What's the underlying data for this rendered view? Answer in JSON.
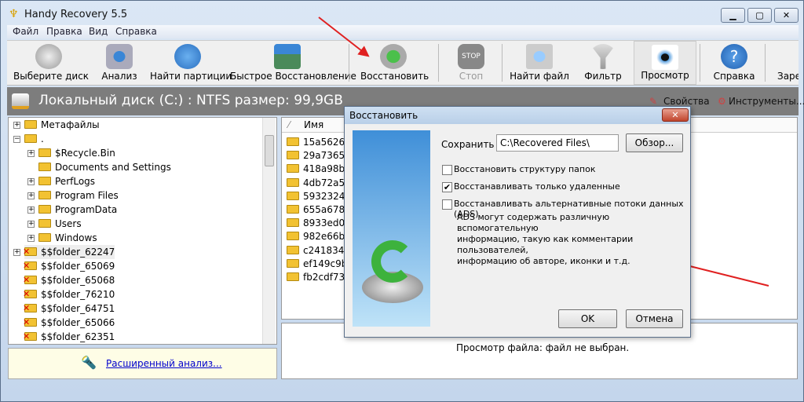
{
  "window": {
    "title": "Handy Recovery 5.5",
    "minimize": "▁",
    "maximize": "▢",
    "close": "✕"
  },
  "menu": [
    "Файл",
    "Правка",
    "Вид",
    "Справка"
  ],
  "toolbar": [
    "Выберите диск",
    "Анализ",
    "Найти партиции",
    "Быстрое Восстановление",
    "Восстановить",
    "Стоп",
    "Найти файл",
    "Фильтр",
    "Просмотр",
    "Справка",
    "Заре"
  ],
  "diskbar": {
    "title": "Локальный диск (C:) : NTFS размер: 99,9GB",
    "properties": "Свойства",
    "tools": "Инструменты..."
  },
  "tree": {
    "root": [
      "Метафайлы",
      "."
    ],
    "children": [
      "$Recycle.Bin",
      "Documents and Settings",
      "PerfLogs",
      "Program Files",
      "ProgramData",
      "Users",
      "Windows"
    ],
    "deleted": [
      "$$folder_62247",
      "$$folder_65069",
      "$$folder_65068",
      "$$folder_76210",
      "$$folder_64751",
      "$$folder_65066",
      "$$folder_62351"
    ]
  },
  "info": {
    "link": "Расширенный анализ..."
  },
  "list": {
    "header": "Имя",
    "files": [
      "15a5626919",
      "29a7365b61",
      "418a98be09",
      "4db72a5277",
      "59323244ea",
      "655a6788e9",
      "8933ed07db",
      "982e66bffd",
      "c241834043",
      "ef149c9b7c",
      "fb2cdf73eb"
    ]
  },
  "preview": {
    "text": "Просмотр файла: файл не выбран."
  },
  "dialog": {
    "title": "Восстановить",
    "save_label": "Сохранить в:",
    "save_path": "C:\\Recovered Files\\",
    "browse": "Обзор...",
    "options": [
      {
        "label": "Восстановить структуру папок",
        "checked": false
      },
      {
        "label": "Восстанавливать только удаленные",
        "checked": true
      },
      {
        "label": "Восстанавливать альтернативные потоки данных (ADS)",
        "checked": false
      }
    ],
    "ads_note": [
      "ADS могут содержать различную вспомогательную",
      "информацию, такую как комментарии пользователей,",
      "информацию об авторе, иконки и т.д."
    ],
    "ok": "OK",
    "cancel": "Отмена"
  }
}
